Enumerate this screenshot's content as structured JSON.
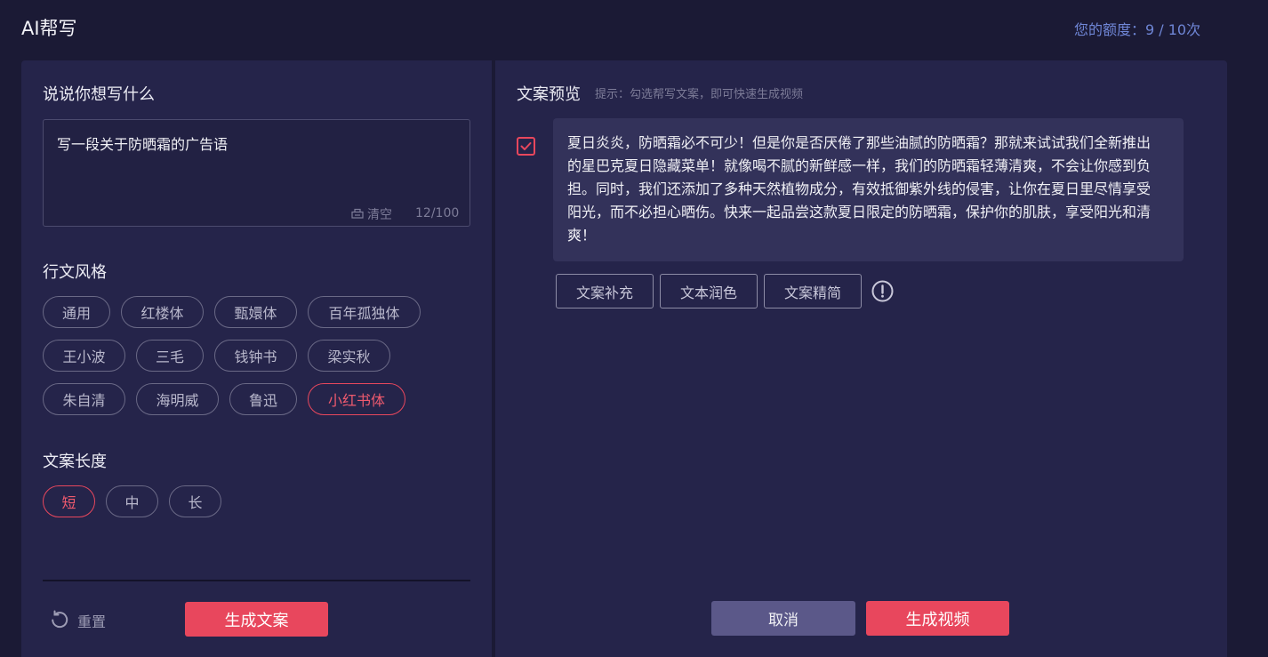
{
  "app": {
    "title": "AI帮写"
  },
  "quota": {
    "text": "您的额度：9 / 10次"
  },
  "left": {
    "prompt_heading": "说说你想写什么",
    "prompt_value": "写一段关于防晒霜的广告语",
    "clear_label": "清空",
    "char_count": "12/100",
    "style_heading": "行文风格",
    "styles": [
      "通用",
      "红楼体",
      "甄嬛体",
      "百年孤独体",
      "王小波",
      "三毛",
      "钱钟书",
      "梁实秋",
      "朱自清",
      "海明威",
      "鲁迅",
      "小红书体"
    ],
    "selected_style": "小红书体",
    "length_heading": "文案长度",
    "lengths": [
      "短",
      "中",
      "长"
    ],
    "selected_length": "短",
    "reset_label": "重置",
    "generate_copy_label": "生成文案"
  },
  "right": {
    "heading": "文案预览",
    "hint": "提示：勾选帮写文案，即可快速生成视频",
    "copy_checked": true,
    "copy_text": "夏日炎炎，防晒霜必不可少！但是你是否厌倦了那些油腻的防晒霜？那就来试试我们全新推出的星巴克夏日隐藏菜单！就像喝不腻的新鲜感一样，我们的防晒霜轻薄清爽，不会让你感到负担。同时，我们还添加了多种天然植物成分，有效抵御紫外线的侵害，让你在夏日里尽情享受阳光，而不必担心晒伤。快来一起品尝这款夏日限定的防晒霜，保护你的肌肤，享受阳光和清爽！",
    "actions": [
      "文案补充",
      "文本润色",
      "文案精简"
    ],
    "cancel_label": "取消",
    "generate_video_label": "生成视频"
  },
  "colors": {
    "background": "#1b1a35",
    "panel": "#25244a",
    "accent": "#e8475d",
    "quota_text": "#6f86d6",
    "secondary_button": "#5b5889"
  },
  "icons": [
    "clear-icon",
    "reset-icon",
    "checkbox-check-icon",
    "info-icon"
  ]
}
